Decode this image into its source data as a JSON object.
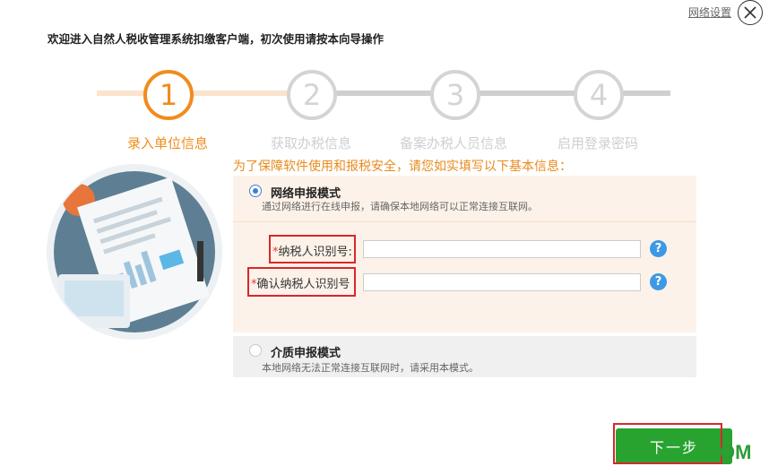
{
  "header": {
    "network_settings": "网络设置",
    "welcome": "欢迎进入自然人税收管理系统扣缴客户端，初次使用请按本向导操作"
  },
  "steps": [
    {
      "number": "1",
      "label": "录入单位信息",
      "active": true
    },
    {
      "number": "2",
      "label": "获取办税信息",
      "active": false
    },
    {
      "number": "3",
      "label": "备案办税人员信息",
      "active": false
    },
    {
      "number": "4",
      "label": "启用登录密码",
      "active": false
    }
  ],
  "notice": "为了保障软件使用和报税安全，请您如实填写以下基本信息：",
  "online_mode": {
    "title": "网络申报模式",
    "desc": "通过网络进行在线申报，请确保本地网络可以正常连接互联网。",
    "selected": true
  },
  "fields": [
    {
      "star": "*",
      "label": "纳税人识别号:",
      "value": "",
      "help": "?"
    },
    {
      "star": "*",
      "label": "确认纳税人识别号",
      "value": "",
      "help": "?"
    }
  ],
  "medium_mode": {
    "title": "介质申报模式",
    "desc": "本地网络无法正常连接互联网时，请采用本模式。",
    "selected": false
  },
  "next_button": "下一步",
  "watermark": "OM",
  "colors": {
    "accent": "#f08c1e",
    "inactive": "#cfcfcf",
    "primary_button": "#29a32f",
    "highlight_box": "#d9262c",
    "help_icon": "#3d99e6"
  }
}
